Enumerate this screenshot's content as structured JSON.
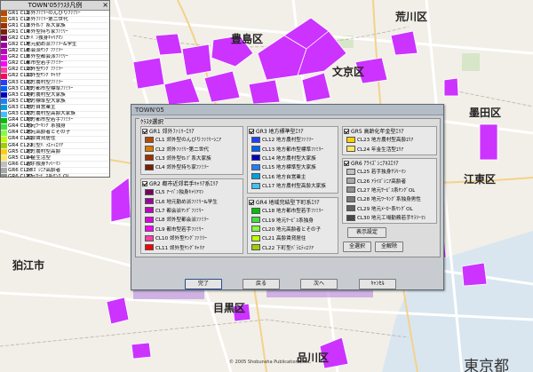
{
  "map": {
    "labels": [
      {
        "id": "arakawa",
        "text": "荒川区"
      },
      {
        "id": "toshima",
        "text": "豊島区"
      },
      {
        "id": "bunkyo",
        "text": "文京区"
      },
      {
        "id": "sumida",
        "text": "墨田区"
      },
      {
        "id": "koto",
        "text": "江東区"
      },
      {
        "id": "komae",
        "text": "狛江市"
      },
      {
        "id": "meguro",
        "text": "目黒区"
      },
      {
        "id": "shinagawa",
        "text": "品川区"
      },
      {
        "id": "tokyo",
        "text": "東京都"
      },
      {
        "id": "copyright",
        "text": "© 2005 Shobunsha Publications, Inc."
      }
    ],
    "highlight_color": "#cc33ff"
  },
  "legend": {
    "title": "TOWN'05ｸﾗｽﾀ凡例",
    "close": "×",
    "rows": [
      {
        "code": "GR1 CL1",
        "name": "郊外ﾌｧﾐﾘｰのんびりﾌｧﾐﾘｰ",
        "color": "#b84a00"
      },
      {
        "code": "GR1 CL2",
        "name": "郊外ﾌｧﾐﾘｰ第二世代",
        "color": "#c86400"
      },
      {
        "code": "GR1 CL3",
        "name": "郊外ｾﾚﾌﾞ系大家族",
        "color": "#a03000"
      },
      {
        "code": "GR1 CL4",
        "name": "郊外型持ち家ﾌｧﾐﾘｰ",
        "color": "#7a2000"
      },
      {
        "code": "GR2 CL5",
        "name": "ｱｰﾊﾞﾝ独身ｷｬﾘｱﾏﾝ",
        "color": "#7a0060"
      },
      {
        "code": "GR2 CL6",
        "name": "地元勤め派ﾌｧﾐﾘｰ&学生",
        "color": "#a000a0"
      },
      {
        "code": "GR2 CL7",
        "name": "都会派ﾔﾝｸﾞﾌｧﾐﾘｰ",
        "color": "#c000c0"
      },
      {
        "code": "GR2 CL8",
        "name": "郊外型都会派ﾌｧﾐﾘｰ",
        "color": "#e000e0"
      },
      {
        "code": "GR2 CL9",
        "name": "都市型若手ﾌｧﾐﾘｰ",
        "color": "#ff00ff"
      },
      {
        "code": "GR2 CL10",
        "name": "郊外型ﾔﾝｸﾞﾌｧﾐﾘｰ",
        "color": "#ff40a0"
      },
      {
        "code": "GR2 CL11",
        "name": "郊外型ﾔﾝｸﾞｷｬﾘｱ",
        "color": "#ff0060"
      },
      {
        "code": "GR3 CL12",
        "name": "地方農村型ﾌｧﾐﾘｰ",
        "color": "#2040ff"
      },
      {
        "code": "GR3 CL13",
        "name": "地方都市型標準ﾌｧﾐﾘｰ",
        "color": "#0060ff"
      },
      {
        "code": "GR3 CL14",
        "name": "地方農村型大家族",
        "color": "#0000c0"
      },
      {
        "code": "GR3 CL15",
        "name": "地方標準型大家族",
        "color": "#2080ff"
      },
      {
        "code": "GR3 CL16",
        "name": "地方自営業主",
        "color": "#00a0e0"
      },
      {
        "code": "GR3 CL17",
        "name": "地方農村型高齢大家族",
        "color": "#40c0ff"
      },
      {
        "code": "GR4 CL18",
        "name": "地方都市型若手ﾌｧﾐﾘｰ",
        "color": "#00c000"
      },
      {
        "code": "GR4 CL19",
        "name": "地元ﾜｰｷﾝｸﾞ系独身",
        "color": "#40e040"
      },
      {
        "code": "GR4 CL20",
        "name": "地元高齢者とその子",
        "color": "#80ff40"
      },
      {
        "code": "GR4 CL21",
        "name": "高齢賃貸居住",
        "color": "#c0ff00"
      },
      {
        "code": "GR4 CL22",
        "name": "下町型ﾊﾞﾗｴﾃｨｴﾘｱ",
        "color": "#a0d000"
      },
      {
        "code": "GR5 CL23",
        "name": "地方農村型高齢",
        "color": "#ffd000"
      },
      {
        "code": "GR5 CL24",
        "name": "年金生活型",
        "color": "#ffe860"
      },
      {
        "code": "GR6 CL25",
        "name": "若手独身ｻﾗﾘｰﾏﾝ",
        "color": "#c0c0c0"
      },
      {
        "code": "GR6 CL26",
        "name": "ｱﾗｲｽﾞｼﾆｱ高齢者",
        "color": "#a8a8a8"
      },
      {
        "code": "GR6 CL27",
        "name": "地元ｻｰﾋﾞｽ系ﾔﾝｸﾞOL",
        "color": "#909090"
      },
      {
        "code": "GR6 CL28",
        "name": "地元ﾜｰｷﾝｸﾞ系独身男性",
        "color": "#787878"
      },
      {
        "code": "GR6 CL29",
        "name": "地元ﾒｰｶｰ系ﾔﾝｸﾞOL",
        "color": "#606060"
      },
      {
        "code": "GR6 CL30",
        "name": "地元工場勤務若手ｻﾗﾘｰﾏﾝ",
        "color": "#484848"
      }
    ]
  },
  "dialog": {
    "title": "TOWN'05",
    "frame_title": "ｸﾗｽﾀ選択",
    "groups": [
      {
        "id": "gr1",
        "checked": true,
        "label": "GR1 郊外ﾌｧﾐﾘｰｴﾘｱ",
        "rows": [
          {
            "label": "CL1 郊外型のんびりﾌｧﾐﾘｰｼﾆｱ",
            "color": "#b84a00",
            "checked": true
          },
          {
            "label": "CL2 郊外ﾌｧﾐﾘｰ第二世代",
            "color": "#e07800",
            "checked": true
          },
          {
            "label": "CL3 郊外型ｾﾚﾌﾞ系大家族",
            "color": "#a03000",
            "checked": true
          },
          {
            "label": "CL4 郊外型持ち家ﾌｧﾐﾘｰ",
            "color": "#7a2000",
            "checked": true
          }
        ]
      },
      {
        "id": "gr2",
        "checked": true,
        "label": "GR2 都市近郊若手ｷｬﾘｱ系ｴﾘｱ",
        "rows": [
          {
            "label": "CL5 ｱｰﾊﾞﾝ独身ｷｬﾘｱﾏﾝ",
            "color": "#7a0060",
            "checked": true
          },
          {
            "label": "CL6 地元勤め派ﾌｧﾐﾘｰ&学生",
            "color": "#a000a0",
            "checked": true
          },
          {
            "label": "CL7 都会派ﾔﾝｸﾞﾌｧﾐﾘｰ",
            "color": "#c000c0",
            "checked": true
          },
          {
            "label": "CL8 郊外型都会派ﾌｧﾐﾘｰ",
            "color": "#e000e0",
            "checked": true
          },
          {
            "label": "CL9 都市型若手ﾌｧﾐﾘｰ",
            "color": "#ff00ff",
            "checked": true
          },
          {
            "label": "CL10 郊外型ﾔﾝｸﾞﾌｧﾐﾘｰ",
            "color": "#ff40a0",
            "checked": true
          },
          {
            "label": "CL11 郊外型ﾔﾝｸﾞｷｬﾘｱ",
            "color": "#ff0000",
            "checked": true
          }
        ]
      },
      {
        "id": "gr3",
        "checked": true,
        "label": "GR3 地方標準型ｴﾘｱ",
        "rows": [
          {
            "label": "CL12 地方農村型ﾌｧﾐﾘｰ",
            "color": "#2040ff",
            "checked": true
          },
          {
            "label": "CL13 地方都市型標準ﾌｧﾐﾘｰ",
            "color": "#0060ff",
            "checked": true
          },
          {
            "label": "CL14 地方農村型大家族",
            "color": "#0000c0",
            "checked": true
          },
          {
            "label": "CL15 地方標準型大家族",
            "color": "#2080ff",
            "checked": true
          },
          {
            "label": "CL16 地方自営業主",
            "color": "#00a0e0",
            "checked": true
          },
          {
            "label": "CL17 地方農村型高齢大家族",
            "color": "#40c0ff",
            "checked": true
          }
        ]
      },
      {
        "id": "gr4",
        "checked": true,
        "label": "GR4 地域完結型下町系ｴﾘｱ",
        "rows": [
          {
            "label": "CL18 地方都市型若手ﾌｧﾐﾘｰ",
            "color": "#00c000",
            "checked": true
          },
          {
            "label": "CL19 地元ｻｰﾋﾞｽ系独身",
            "color": "#40e040",
            "checked": true
          },
          {
            "label": "CL20 地元高齢者とその子",
            "color": "#80ff40",
            "checked": true
          },
          {
            "label": "CL21 高齢賃貸居住",
            "color": "#c0ff00",
            "checked": true
          },
          {
            "label": "CL22 下町型ﾊﾞﾗｴﾃｨｴﾘｱ",
            "color": "#a0d000",
            "checked": true
          }
        ]
      },
      {
        "id": "gr5",
        "checked": true,
        "label": "GR5 高齢化年金型ｴﾘｱ",
        "rows": [
          {
            "label": "CL23 地方農村型高齢ｴﾘｱ",
            "color": "#ffd000",
            "checked": true
          },
          {
            "label": "CL24 年金生活型ｴﾘｱ",
            "color": "#ffe860",
            "checked": true
          }
        ]
      },
      {
        "id": "gr6",
        "checked": true,
        "label": "GR6 ｱﾗｲｽﾞｼﾆｱﾈｽｴﾘｱ",
        "rows": [
          {
            "label": "CL25 若手独身ｻﾗﾘｰﾏﾝ",
            "color": "#c0c0c0",
            "checked": true
          },
          {
            "label": "CL26 ｱﾗｲｽﾞｼﾆｱ高齢者",
            "color": "#a8a8a8",
            "checked": true
          },
          {
            "label": "CL27 地元ｻｰﾋﾞｽ系ﾔﾝｸﾞOL",
            "color": "#909090",
            "checked": true
          },
          {
            "label": "CL28 地元ﾜｰｷﾝｸﾞ系独身男性",
            "color": "#787878",
            "checked": true
          },
          {
            "label": "CL29 地元ﾒｰｶｰ系ﾔﾝｸﾞOL",
            "color": "#606060",
            "checked": true
          },
          {
            "label": "CL30 地元工場勤務若手ｻﾗﾘｰﾏﾝ",
            "color": "#484848",
            "checked": true
          }
        ]
      }
    ],
    "buttons": {
      "display_settings": "表示設定",
      "select_all": "全選択",
      "deselect_all": "全解除",
      "finish": "完了",
      "back": "戻る",
      "next": "次へ",
      "cancel": "ｷｬﾝｾﾙ"
    }
  }
}
